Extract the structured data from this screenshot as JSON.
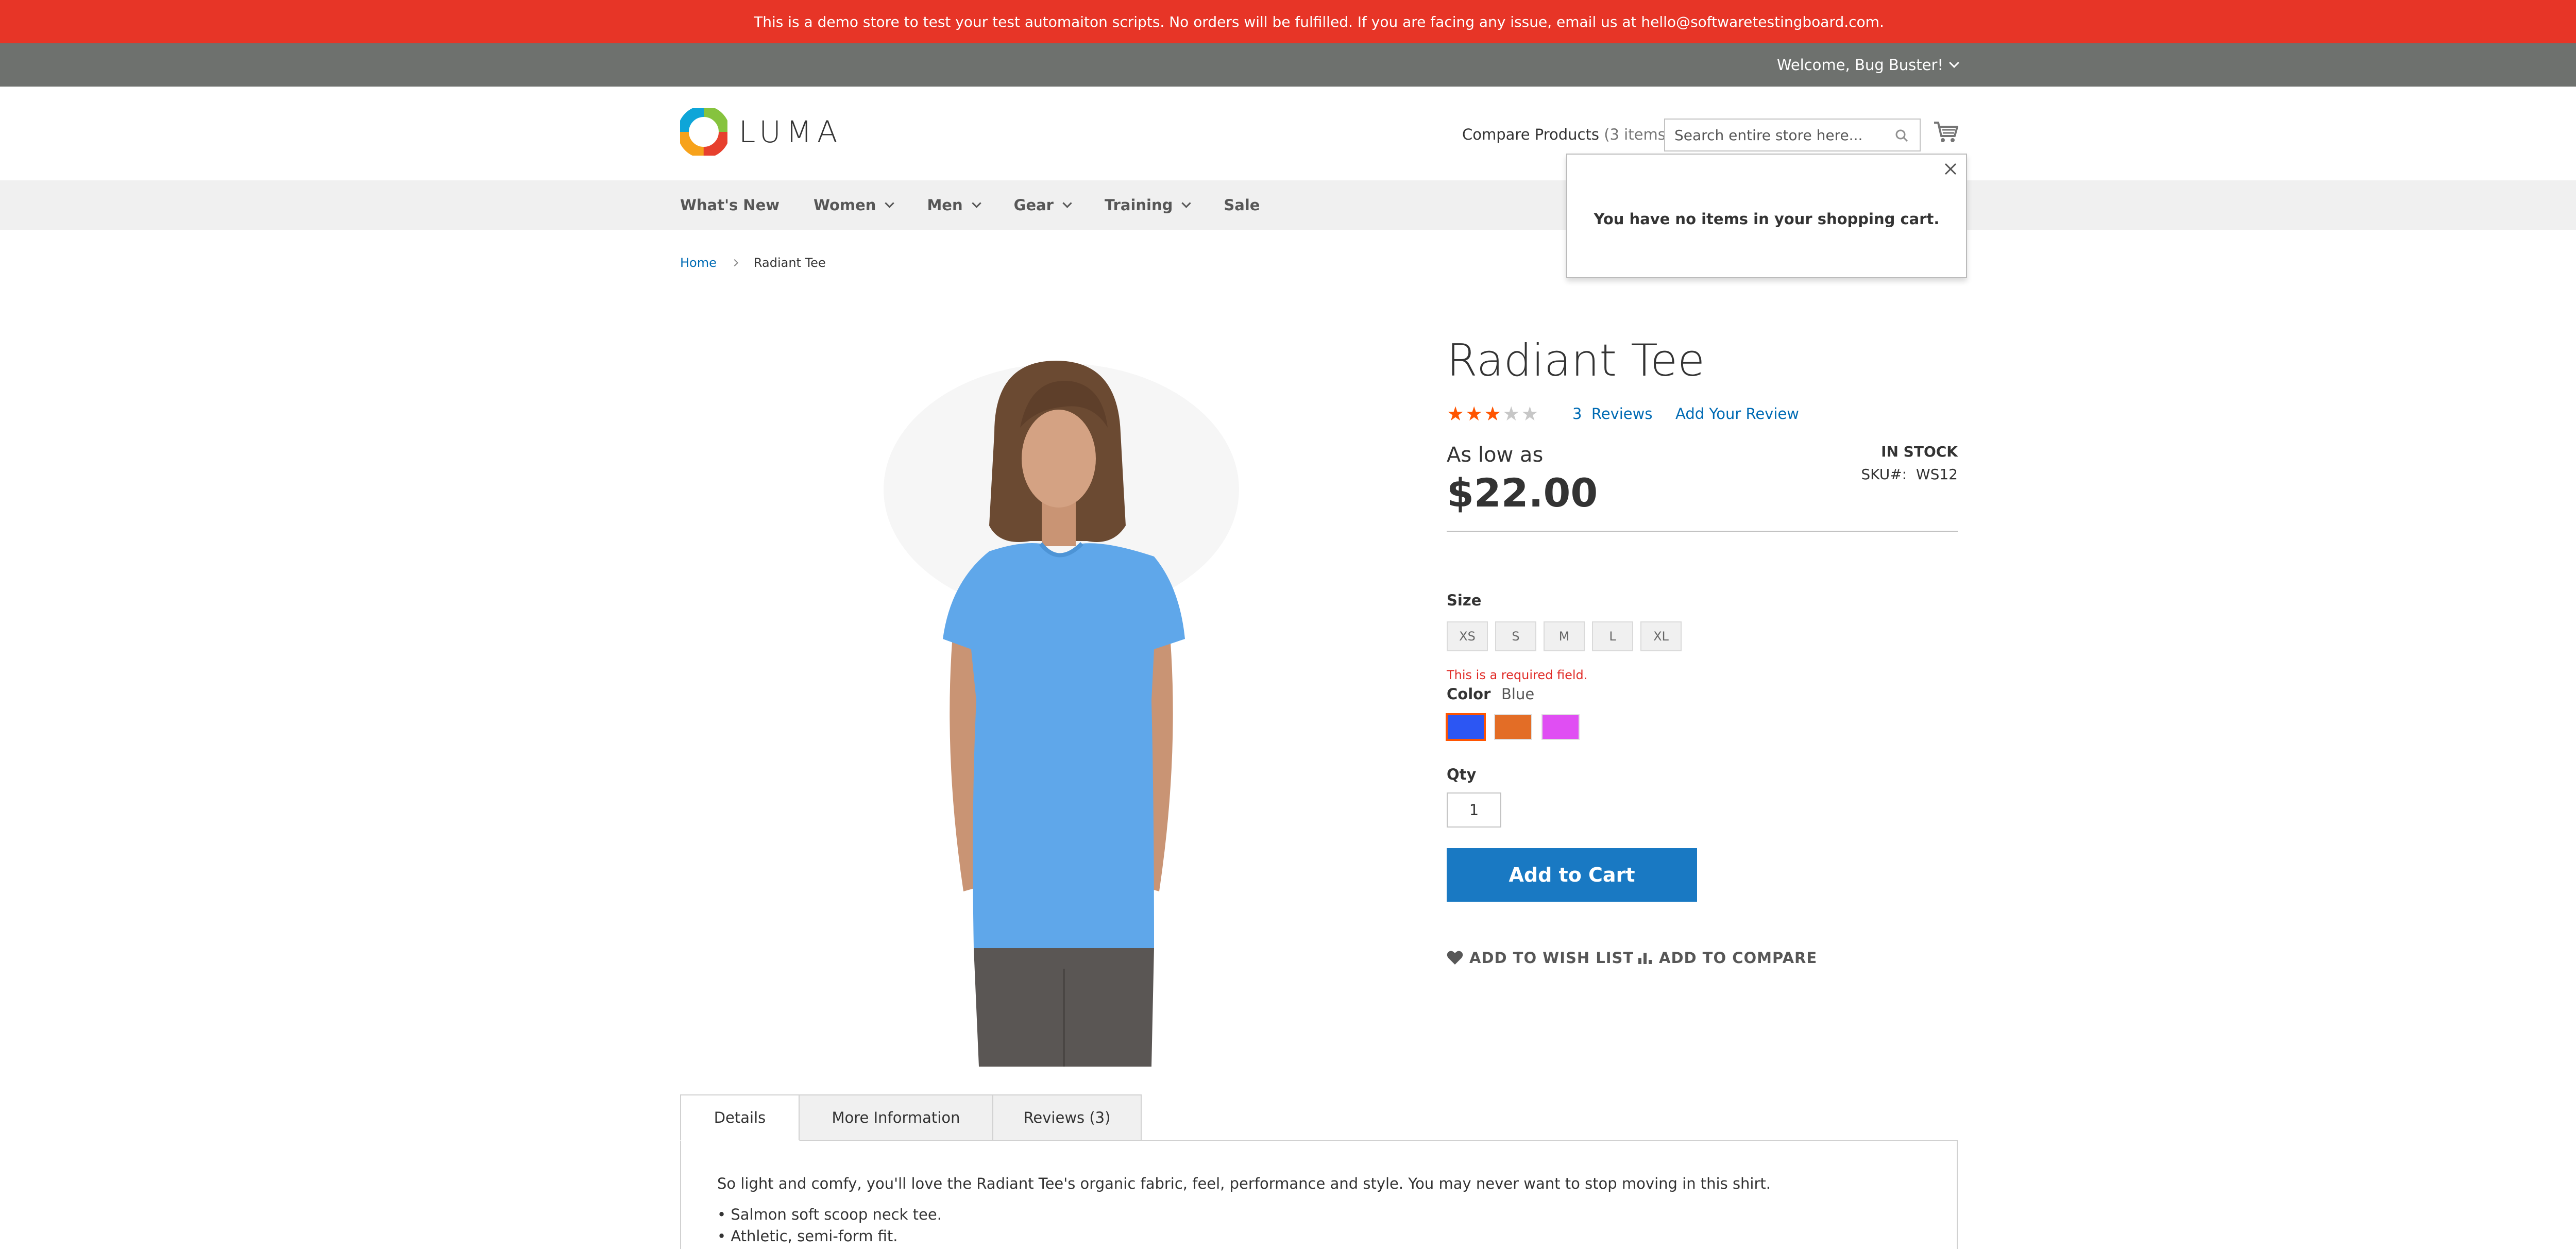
{
  "notice": {
    "text": "This is a demo store to test your test automaiton scripts. No orders will be fulfilled. If you are facing any issue, email us at hello@softwaretestingboard.com."
  },
  "header": {
    "welcome": "Welcome, Bug Buster!",
    "logo_text": "LUMA",
    "compare_label": "Compare Products",
    "compare_count": "(3 items)",
    "search_placeholder": "Search entire store here..."
  },
  "nav": {
    "items": [
      {
        "label": "What's New",
        "has_dropdown": false
      },
      {
        "label": "Women",
        "has_dropdown": true
      },
      {
        "label": "Men",
        "has_dropdown": true
      },
      {
        "label": "Gear",
        "has_dropdown": true
      },
      {
        "label": "Training",
        "has_dropdown": true
      },
      {
        "label": "Sale",
        "has_dropdown": false
      }
    ]
  },
  "minicart": {
    "empty_message": "You have no items in your shopping cart."
  },
  "breadcrumb": {
    "home": "Home",
    "current": "Radiant Tee"
  },
  "product": {
    "name": "Radiant Tee",
    "rating_stars": 3,
    "rating_max": 5,
    "reviews_count": "3",
    "reviews_label": "Reviews",
    "add_review": "Add Your Review",
    "price_prefix": "As low as",
    "price": "$22.00",
    "stock": "IN STOCK",
    "sku_label": "SKU#:",
    "sku": "WS12",
    "size_label": "Size",
    "sizes": [
      "XS",
      "S",
      "M",
      "L",
      "XL"
    ],
    "required_error": "This is a required field.",
    "color_label": "Color",
    "color_selected": "Blue",
    "colors": [
      {
        "name": "Blue",
        "hex": "#2c56f3"
      },
      {
        "name": "Orange",
        "hex": "#e36d26"
      },
      {
        "name": "Purple",
        "hex": "#e04ef3"
      }
    ],
    "qty_label": "Qty",
    "qty_value": "1",
    "add_to_cart": "Add to Cart",
    "wishlist": "ADD TO WISH LIST",
    "compare": "ADD TO COMPARE"
  },
  "tabs": {
    "items": [
      "Details",
      "More Information",
      "Reviews (3)"
    ],
    "active": 0,
    "description": "So light and comfy, you'll love the Radiant Tee's organic fabric, feel, performance and style. You may never want to stop moving in this shirt.",
    "bullets": [
      "• Salmon soft scoop neck tee.",
      "• Athletic, semi-form fit."
    ]
  },
  "colors": {
    "notice_bg": "#e73527",
    "panel_bg": "#6e716e",
    "nav_bg": "#f0f0f0",
    "link": "#006bb4",
    "primary_button": "#1979c3",
    "rating": "#ff5501"
  }
}
